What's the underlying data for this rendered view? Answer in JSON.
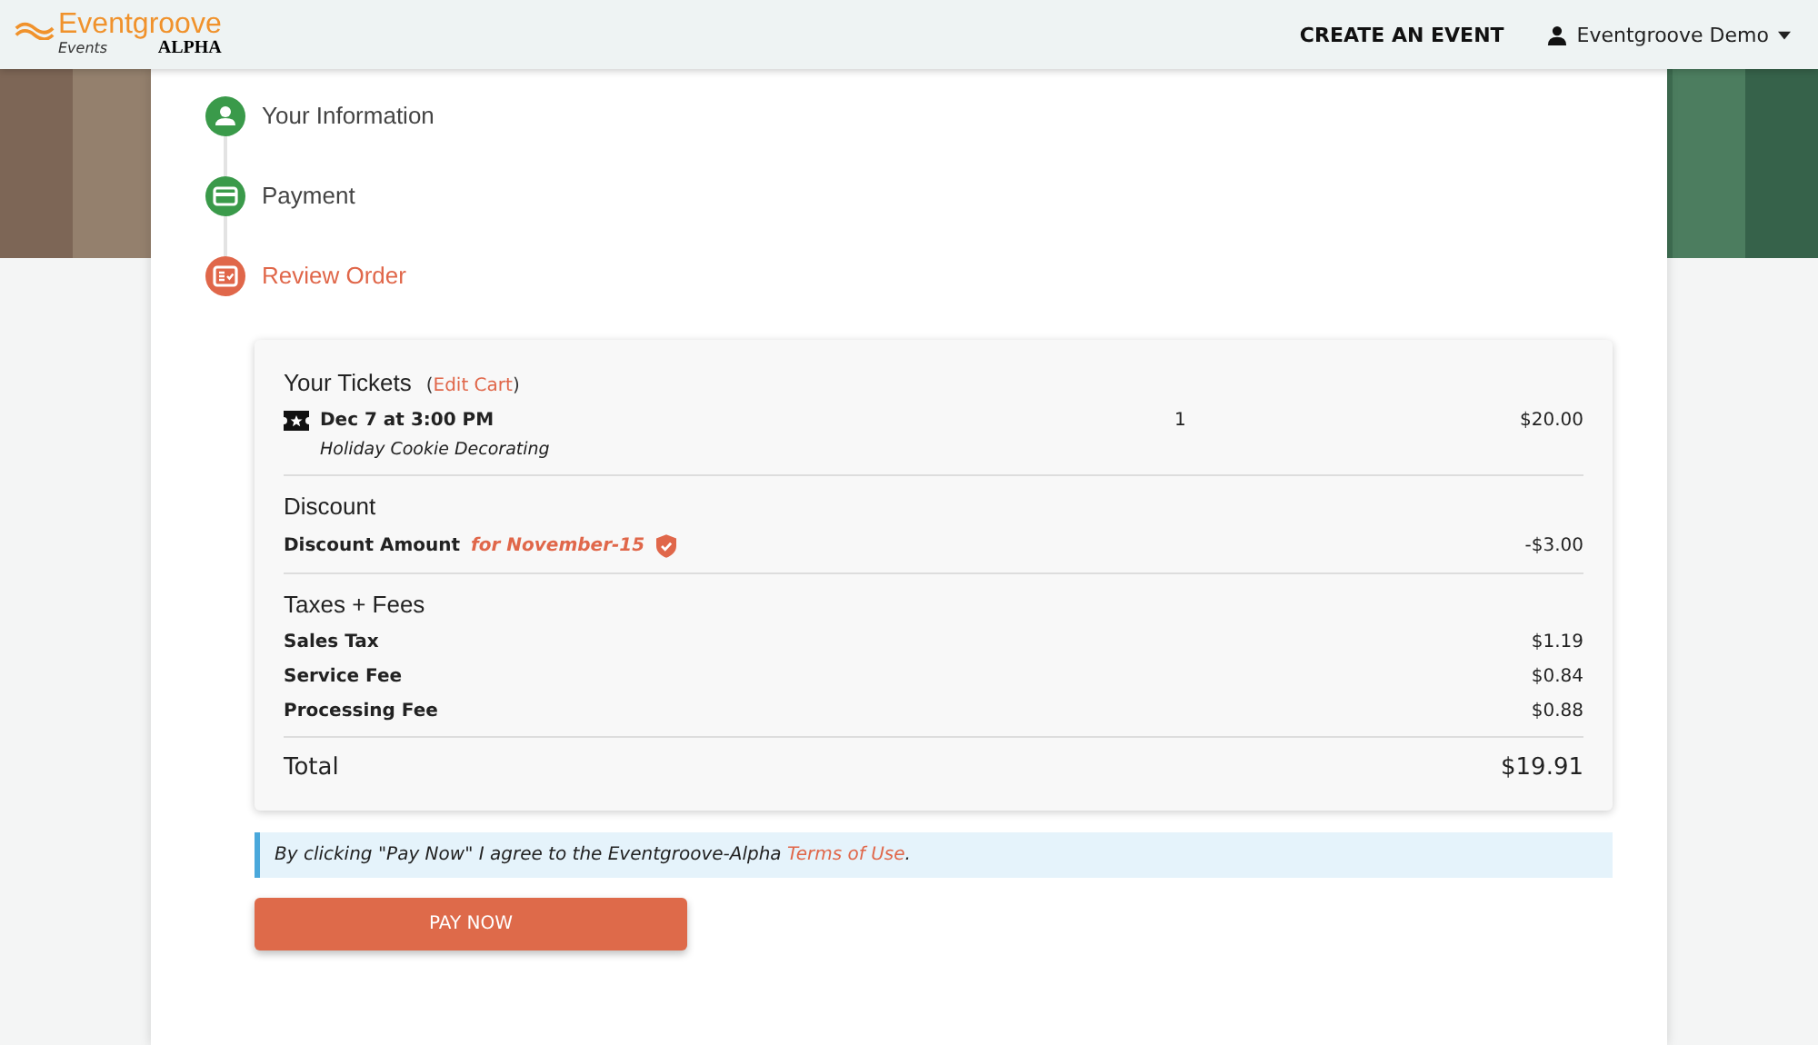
{
  "header": {
    "logo": {
      "name": "Eventgroove",
      "sub": "Events",
      "badge": "ALPHA"
    },
    "create_link": "CREATE AN EVENT",
    "user_menu": "Eventgroove Demo"
  },
  "steps": [
    {
      "label": "Your Information",
      "selected": false,
      "kind": "user"
    },
    {
      "label": "Payment",
      "selected": false,
      "kind": "card"
    },
    {
      "label": "Review Order",
      "selected": true,
      "kind": "review"
    }
  ],
  "order": {
    "tickets": {
      "title": "Your Tickets",
      "edit_open": "(",
      "edit_link": "Edit Cart",
      "edit_close": ")",
      "items": [
        {
          "date": "Dec 7 at 3:00 PM",
          "event": "Holiday Cookie Decorating",
          "quantity": "1",
          "price": "$20.00"
        }
      ]
    },
    "discount": {
      "title": "Discount",
      "label": "Discount Amount",
      "code": "for November-15",
      "amount": "-$3.00"
    },
    "taxes": {
      "title": "Taxes + Fees",
      "rows": [
        {
          "label": "Sales Tax",
          "amount": "$1.19"
        },
        {
          "label": "Service Fee",
          "amount": "$0.84"
        },
        {
          "label": "Processing Fee",
          "amount": "$0.88"
        }
      ]
    },
    "total": {
      "label": "Total",
      "amount": "$19.91"
    }
  },
  "notice": {
    "text": "By clicking \"Pay Now\" I agree to the Eventgroove-Alpha ",
    "link": "Terms of Use",
    "end": "."
  },
  "pay_button": "PAY NOW"
}
